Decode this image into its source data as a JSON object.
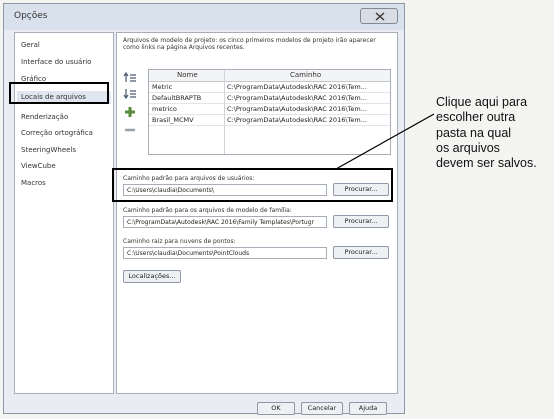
{
  "dialog": {
    "title": "Opções"
  },
  "sidebar": {
    "items": [
      {
        "label": "Geral"
      },
      {
        "label": "Interface do usuário"
      },
      {
        "label": "Gráfico"
      },
      {
        "label": "Locais de arquivos"
      },
      {
        "label": "Renderização"
      },
      {
        "label": "Correção ortográfica"
      },
      {
        "label": "SteeringWheels"
      },
      {
        "label": "ViewCube"
      },
      {
        "label": "Macros"
      }
    ],
    "selected_index": 3
  },
  "project_templates": {
    "description_line1": "Arquivos de modelo de projeto: os cinco primeiros modelos de projeto irão aparecer",
    "description_line2": "como links na página Arquivos recentes.",
    "columns": [
      "Nome",
      "Caminho"
    ],
    "rows": [
      {
        "name": "Metric",
        "path": "C:\\ProgramData\\Autodesk\\RAC 2016\\Tem..."
      },
      {
        "name": "DefaultBRAPTB",
        "path": "C:\\ProgramData\\Autodesk\\RAC 2016\\Tem..."
      },
      {
        "name": "metrico",
        "path": "C:\\ProgramData\\Autodesk\\RAC 2016\\Tem..."
      },
      {
        "name": "Brasil_MCMV",
        "path": "C:\\ProgramData\\Autodesk\\RAC 2016\\Tem..."
      }
    ]
  },
  "user_files": {
    "label": "Caminho padrão para arquivos de usuários:",
    "value": "C:\\Users\\claudia\\Documents\\",
    "browse_label": "Procurar..."
  },
  "family_templates": {
    "label": "Caminho padrão para os arquivos de modelo de família:",
    "value": "C:\\ProgramData\\Autodesk\\RAC 2016\\Family Templates\\Portugr",
    "browse_label": "Procurar..."
  },
  "point_clouds": {
    "label": "Caminho raiz para nuvens de pontos:",
    "value": "C:\\Users\\claudia\\Documents\\PointClouds",
    "browse_label": "Procurar..."
  },
  "locations_button": "Localizações...",
  "footer": {
    "ok": "OK",
    "cancel": "Cancelar",
    "help": "Ajuda"
  },
  "annotation": {
    "lines": [
      "Clique aqui para",
      "escolher outra",
      "pasta na qual",
      "os arquivos",
      "devem ser salvos."
    ]
  },
  "icons": {
    "move_up": "move-up-icon",
    "move_down": "move-down-icon",
    "add": "add-icon",
    "remove": "remove-icon",
    "close": "close-icon"
  }
}
